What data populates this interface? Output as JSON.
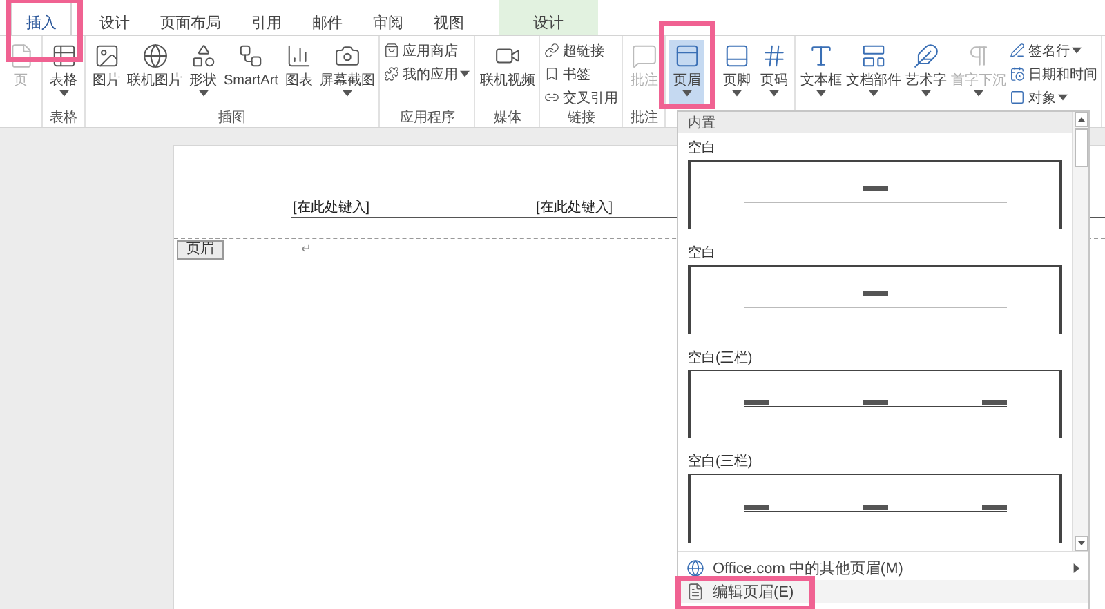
{
  "tabs": [
    {
      "label": "插入",
      "selected": true,
      "highlighted": true,
      "contextual": false
    },
    {
      "label": "设计",
      "selected": false,
      "highlighted": false,
      "contextual": false
    },
    {
      "label": "页面布局",
      "selected": false,
      "highlighted": false,
      "contextual": false
    },
    {
      "label": "引用",
      "selected": false,
      "highlighted": false,
      "contextual": false
    },
    {
      "label": "邮件",
      "selected": false,
      "highlighted": false,
      "contextual": false
    },
    {
      "label": "审阅",
      "selected": false,
      "highlighted": false,
      "contextual": false
    },
    {
      "label": "视图",
      "selected": false,
      "highlighted": false,
      "contextual": false
    },
    {
      "label": "设计",
      "selected": false,
      "highlighted": false,
      "contextual": true
    }
  ],
  "ribbon": {
    "groups": [
      {
        "items": [
          {
            "kind": "large",
            "label": "页",
            "dropdown": false,
            "disabled": true,
            "selected": false,
            "highlighted": false
          }
        ]
      },
      {
        "label": "表格",
        "items": [
          {
            "kind": "large",
            "label": "表格",
            "dropdown": true,
            "disabled": false,
            "selected": false,
            "highlighted": false
          }
        ]
      },
      {
        "label": "插图",
        "items": [
          {
            "kind": "large",
            "label": "图片",
            "dropdown": false,
            "disabled": false,
            "selected": false,
            "highlighted": false
          },
          {
            "kind": "large",
            "label": "联机图片",
            "dropdown": false,
            "disabled": false,
            "selected": false,
            "highlighted": false
          },
          {
            "kind": "large",
            "label": "形状",
            "dropdown": true,
            "disabled": false,
            "selected": false,
            "highlighted": false
          },
          {
            "kind": "large",
            "label": "SmartArt",
            "dropdown": false,
            "disabled": false,
            "selected": false,
            "highlighted": false
          },
          {
            "kind": "large",
            "label": "图表",
            "dropdown": false,
            "disabled": false,
            "selected": false,
            "highlighted": false
          },
          {
            "kind": "large",
            "label": "屏幕截图",
            "dropdown": true,
            "disabled": false,
            "selected": false,
            "highlighted": false
          }
        ]
      },
      {
        "label": "应用程序",
        "items": [
          {
            "kind": "small",
            "label": "应用商店",
            "dropdown": false,
            "disabled": false,
            "selected": false,
            "highlighted": false
          },
          {
            "kind": "small",
            "label": "我的应用",
            "dropdown": true,
            "disabled": false,
            "selected": false,
            "highlighted": false
          }
        ]
      },
      {
        "label": "媒体",
        "items": [
          {
            "kind": "large",
            "label": "联机视频",
            "dropdown": false,
            "disabled": false,
            "selected": false,
            "highlighted": false
          }
        ]
      },
      {
        "label": "链接",
        "items": [
          {
            "kind": "small",
            "label": "超链接",
            "dropdown": false,
            "disabled": false,
            "selected": false,
            "highlighted": false
          },
          {
            "kind": "small",
            "label": "书签",
            "dropdown": false,
            "disabled": false,
            "selected": false,
            "highlighted": false
          },
          {
            "kind": "small",
            "label": "交叉引用",
            "dropdown": false,
            "disabled": false,
            "selected": false,
            "highlighted": false
          }
        ]
      },
      {
        "label": "批注",
        "items": [
          {
            "kind": "large",
            "label": "批注",
            "dropdown": false,
            "disabled": true,
            "selected": false,
            "highlighted": false
          }
        ]
      },
      {
        "items": [
          {
            "kind": "large",
            "label": "页眉",
            "dropdown": true,
            "disabled": false,
            "selected": true,
            "highlighted": true
          },
          {
            "kind": "large",
            "label": "页脚",
            "dropdown": true,
            "disabled": false,
            "selected": false,
            "highlighted": false
          },
          {
            "kind": "large",
            "label": "页码",
            "dropdown": true,
            "disabled": false,
            "selected": false,
            "highlighted": false
          }
        ]
      },
      {
        "items": [
          {
            "kind": "large",
            "label": "文本框",
            "dropdown": true,
            "disabled": false,
            "selected": false,
            "highlighted": false
          },
          {
            "kind": "large",
            "label": "文档部件",
            "dropdown": true,
            "disabled": false,
            "selected": false,
            "highlighted": false
          },
          {
            "kind": "large",
            "label": "艺术字",
            "dropdown": true,
            "disabled": false,
            "selected": false,
            "highlighted": false
          },
          {
            "kind": "large",
            "label": "首字下沉",
            "dropdown": true,
            "disabled": true,
            "selected": false,
            "highlighted": false
          },
          {
            "kind": "small",
            "label": "签名行",
            "dropdown": true,
            "disabled": false,
            "selected": false,
            "highlighted": false
          },
          {
            "kind": "small",
            "label": "日期和时间",
            "dropdown": false,
            "disabled": false,
            "selected": false,
            "highlighted": false
          },
          {
            "kind": "small",
            "label": "对象",
            "dropdown": true,
            "disabled": false,
            "selected": false,
            "highlighted": false
          }
        ]
      }
    ]
  },
  "document": {
    "header_fields": [
      "[在此处键入]",
      "[在此处键入]"
    ],
    "paragraph_mark": "↵",
    "header_tag": "页眉"
  },
  "dropdown": {
    "section": "内置",
    "gallery": [
      {
        "title": "空白",
        "kind": "single"
      },
      {
        "title": "空白",
        "kind": "single"
      },
      {
        "title": "空白(三栏)",
        "kind": "three"
      },
      {
        "title": "空白(三栏)",
        "kind": "three"
      }
    ],
    "menu": [
      {
        "label": "Office.com 中的其他页眉(M)",
        "submenu": true,
        "highlighted": false
      },
      {
        "label": "编辑页眉(E)",
        "submenu": false,
        "highlighted": true
      }
    ]
  }
}
